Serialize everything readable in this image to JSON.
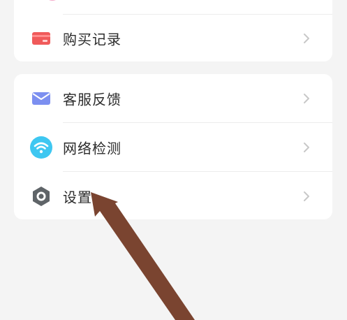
{
  "menu_group_1": {
    "items": [
      {
        "label": "购买记录",
        "icon": "card-icon"
      }
    ]
  },
  "menu_group_2": {
    "items": [
      {
        "label": "客服反馈",
        "icon": "mail-icon"
      },
      {
        "label": "网络检测",
        "icon": "wifi-icon"
      },
      {
        "label": "设置",
        "icon": "settings-icon"
      }
    ]
  },
  "colors": {
    "background": "#f4f4f4",
    "card": "#ffffff",
    "purchase_icon": "#f05a5a",
    "mail_icon": "#7c8ff0",
    "wifi_icon": "#3ec7f1",
    "settings_icon": "#5f6468",
    "arrow": "#7a4430"
  }
}
